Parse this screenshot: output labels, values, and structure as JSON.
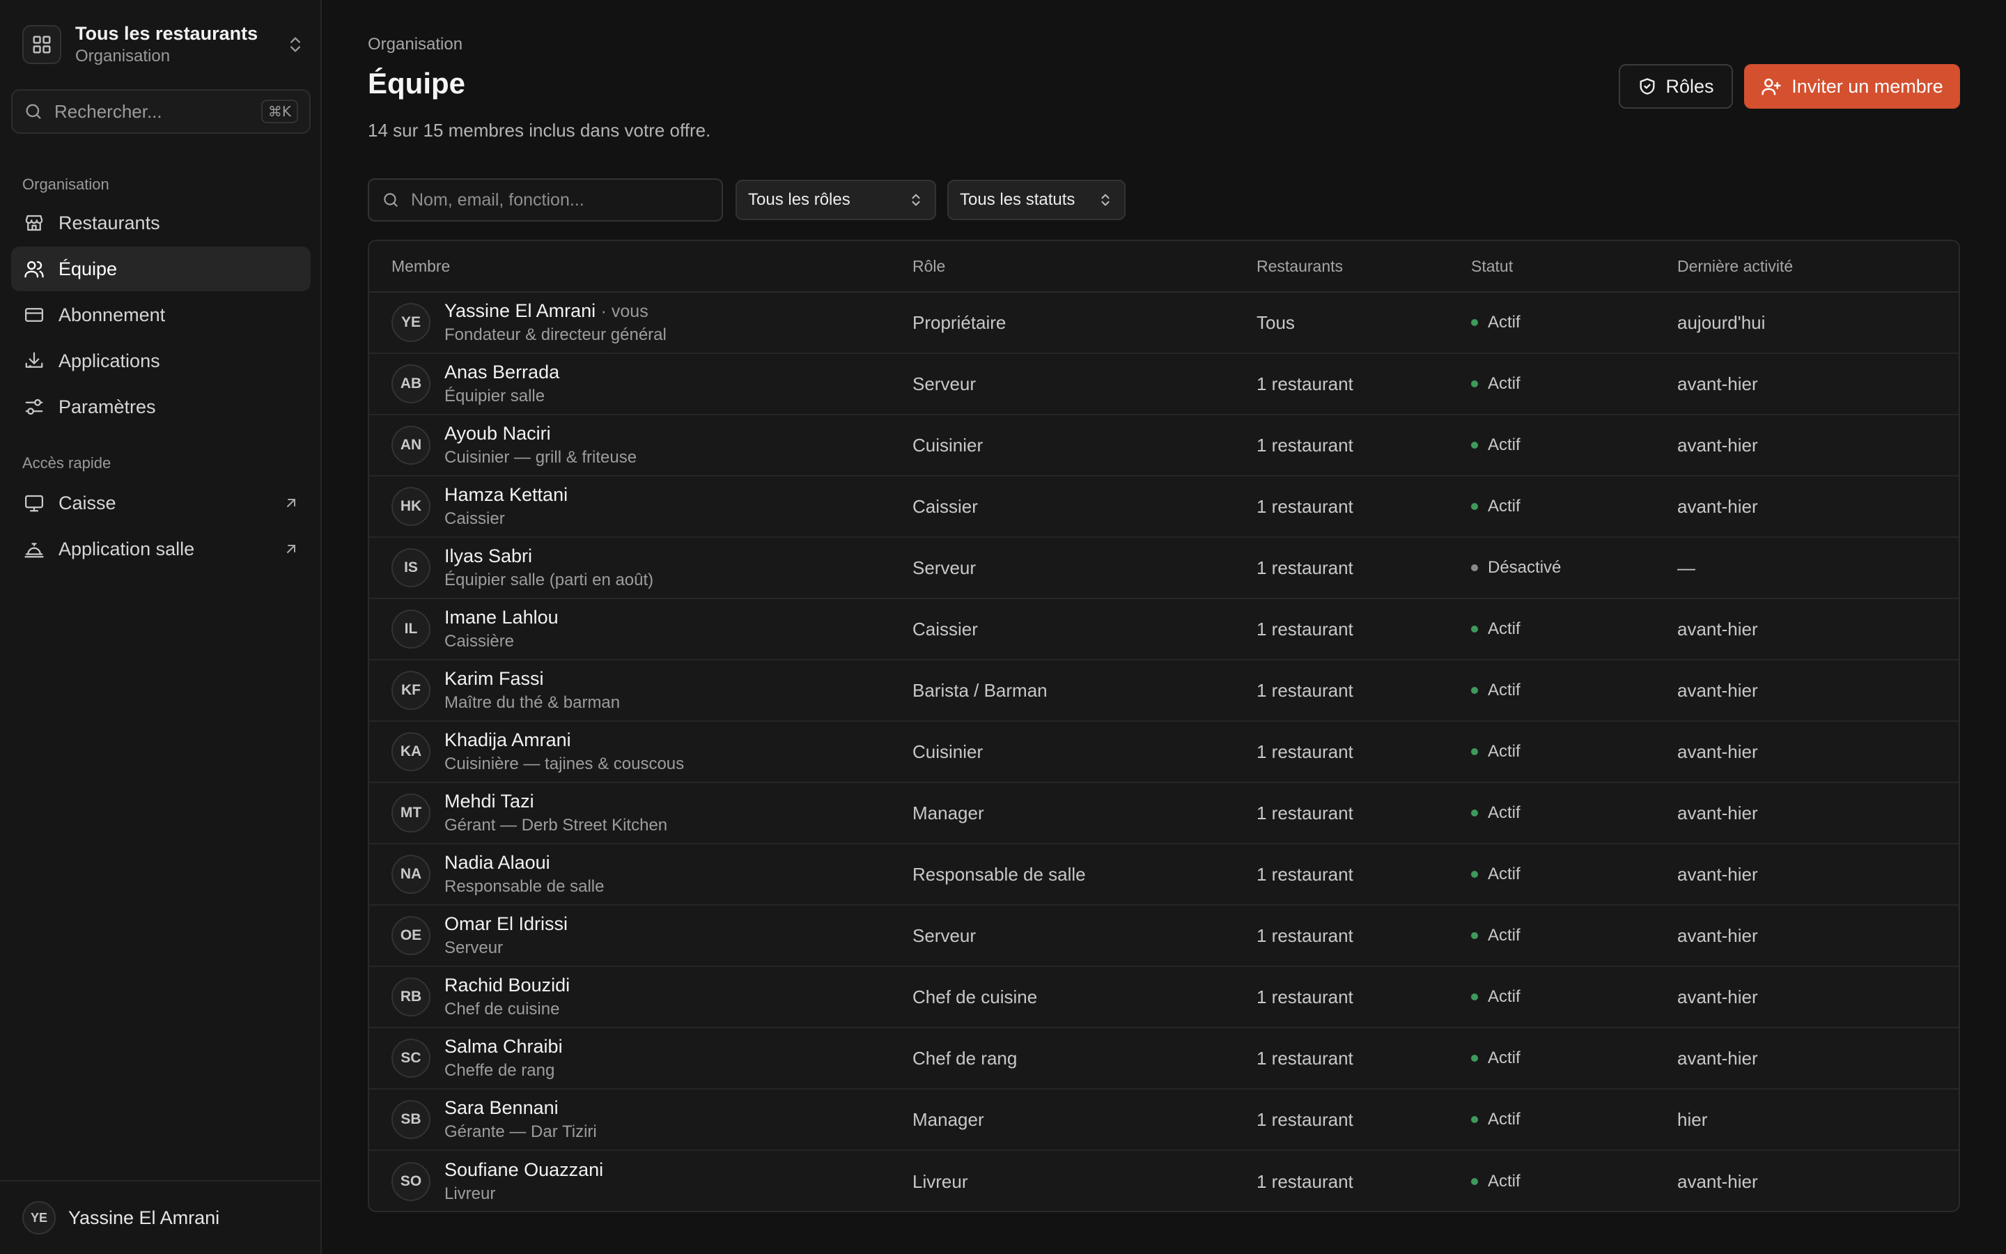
{
  "sidebar": {
    "org_title": "Tous les restaurants",
    "org_subtitle": "Organisation",
    "search_placeholder": "Rechercher...",
    "search_shortcut": "⌘K",
    "section_org": "Organisation",
    "nav": [
      {
        "label": "Restaurants",
        "icon": "store-icon"
      },
      {
        "label": "Équipe",
        "icon": "users-icon",
        "active": true
      },
      {
        "label": "Abonnement",
        "icon": "credit-card-icon"
      },
      {
        "label": "Applications",
        "icon": "download-icon"
      },
      {
        "label": "Paramètres",
        "icon": "sliders-icon"
      }
    ],
    "section_quick": "Accès rapide",
    "quick": [
      {
        "label": "Caisse",
        "icon": "monitor-icon"
      },
      {
        "label": "Application salle",
        "icon": "bell-service-icon"
      }
    ],
    "user_initials": "YE",
    "user_name": "Yassine El Amrani"
  },
  "header": {
    "breadcrumb": "Organisation",
    "title": "Équipe",
    "subtitle": "14 sur 15 membres inclus dans votre offre.",
    "roles_button": "Rôles",
    "invite_button": "Inviter un membre"
  },
  "filters": {
    "search_placeholder": "Nom, email, fonction...",
    "roles_select": "Tous les rôles",
    "status_select": "Tous les statuts"
  },
  "colors": {
    "accent": "#d4502f",
    "status_active": "#3e9a5c",
    "status_inactive": "#8a8a8a"
  },
  "table": {
    "headers": {
      "member": "Membre",
      "role": "Rôle",
      "restaurants": "Restaurants",
      "status": "Statut",
      "activity": "Dernière activité"
    },
    "rows": [
      {
        "initials": "YE",
        "name": "Yassine El Amrani",
        "you": "· vous",
        "function": "Fondateur & directeur général",
        "role": "Propriétaire",
        "restaurants": "Tous",
        "status": "Actif",
        "active": true,
        "activity": "aujourd'hui"
      },
      {
        "initials": "AB",
        "name": "Anas Berrada",
        "you": "",
        "function": "Équipier salle",
        "role": "Serveur",
        "restaurants": "1 restaurant",
        "status": "Actif",
        "active": true,
        "activity": "avant-hier"
      },
      {
        "initials": "AN",
        "name": "Ayoub Naciri",
        "you": "",
        "function": "Cuisinier — grill & friteuse",
        "role": "Cuisinier",
        "restaurants": "1 restaurant",
        "status": "Actif",
        "active": true,
        "activity": "avant-hier"
      },
      {
        "initials": "HK",
        "name": "Hamza Kettani",
        "you": "",
        "function": "Caissier",
        "role": "Caissier",
        "restaurants": "1 restaurant",
        "status": "Actif",
        "active": true,
        "activity": "avant-hier"
      },
      {
        "initials": "IS",
        "name": "Ilyas Sabri",
        "you": "",
        "function": "Équipier salle (parti en août)",
        "role": "Serveur",
        "restaurants": "1 restaurant",
        "status": "Désactivé",
        "active": false,
        "activity": "—"
      },
      {
        "initials": "IL",
        "name": "Imane Lahlou",
        "you": "",
        "function": "Caissière",
        "role": "Caissier",
        "restaurants": "1 restaurant",
        "status": "Actif",
        "active": true,
        "activity": "avant-hier"
      },
      {
        "initials": "KF",
        "name": "Karim Fassi",
        "you": "",
        "function": "Maître du thé & barman",
        "role": "Barista / Barman",
        "restaurants": "1 restaurant",
        "status": "Actif",
        "active": true,
        "activity": "avant-hier"
      },
      {
        "initials": "KA",
        "name": "Khadija Amrani",
        "you": "",
        "function": "Cuisinière — tajines & couscous",
        "role": "Cuisinier",
        "restaurants": "1 restaurant",
        "status": "Actif",
        "active": true,
        "activity": "avant-hier"
      },
      {
        "initials": "MT",
        "name": "Mehdi Tazi",
        "you": "",
        "function": "Gérant — Derb Street Kitchen",
        "role": "Manager",
        "restaurants": "1 restaurant",
        "status": "Actif",
        "active": true,
        "activity": "avant-hier"
      },
      {
        "initials": "NA",
        "name": "Nadia Alaoui",
        "you": "",
        "function": "Responsable de salle",
        "role": "Responsable de salle",
        "restaurants": "1 restaurant",
        "status": "Actif",
        "active": true,
        "activity": "avant-hier"
      },
      {
        "initials": "OE",
        "name": "Omar El Idrissi",
        "you": "",
        "function": "Serveur",
        "role": "Serveur",
        "restaurants": "1 restaurant",
        "status": "Actif",
        "active": true,
        "activity": "avant-hier"
      },
      {
        "initials": "RB",
        "name": "Rachid Bouzidi",
        "you": "",
        "function": "Chef de cuisine",
        "role": "Chef de cuisine",
        "restaurants": "1 restaurant",
        "status": "Actif",
        "active": true,
        "activity": "avant-hier"
      },
      {
        "initials": "SC",
        "name": "Salma Chraibi",
        "you": "",
        "function": "Cheffe de rang",
        "role": "Chef de rang",
        "restaurants": "1 restaurant",
        "status": "Actif",
        "active": true,
        "activity": "avant-hier"
      },
      {
        "initials": "SB",
        "name": "Sara Bennani",
        "you": "",
        "function": "Gérante — Dar Tiziri",
        "role": "Manager",
        "restaurants": "1 restaurant",
        "status": "Actif",
        "active": true,
        "activity": "hier"
      },
      {
        "initials": "SO",
        "name": "Soufiane Ouazzani",
        "you": "",
        "function": "Livreur",
        "role": "Livreur",
        "restaurants": "1 restaurant",
        "status": "Actif",
        "active": true,
        "activity": "avant-hier"
      }
    ]
  }
}
